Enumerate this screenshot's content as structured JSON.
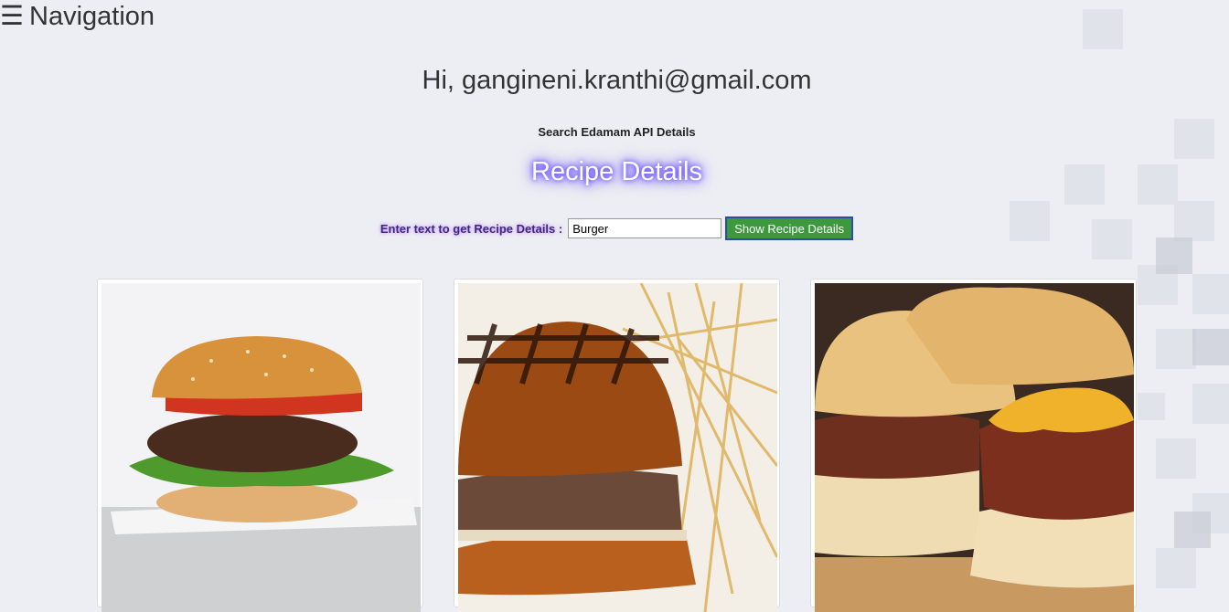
{
  "nav": {
    "icon": "menu-icon",
    "label": "Navigation"
  },
  "greeting": "Hi, gangineni.kranthi@gmail.com",
  "subtitle": "Search Edamam API Details",
  "title": "Recipe Details",
  "search": {
    "label": "Enter text to get Recipe Details :",
    "value": "Burger",
    "button": "Show Recipe Details"
  },
  "recipes": [
    {
      "image": "burger-photo-1"
    },
    {
      "image": "burger-photo-2"
    },
    {
      "image": "burger-photo-3"
    }
  ],
  "colors": {
    "accent_green": "#3c9a3c",
    "glow": "#6a4dff",
    "background": "#eceef3"
  }
}
